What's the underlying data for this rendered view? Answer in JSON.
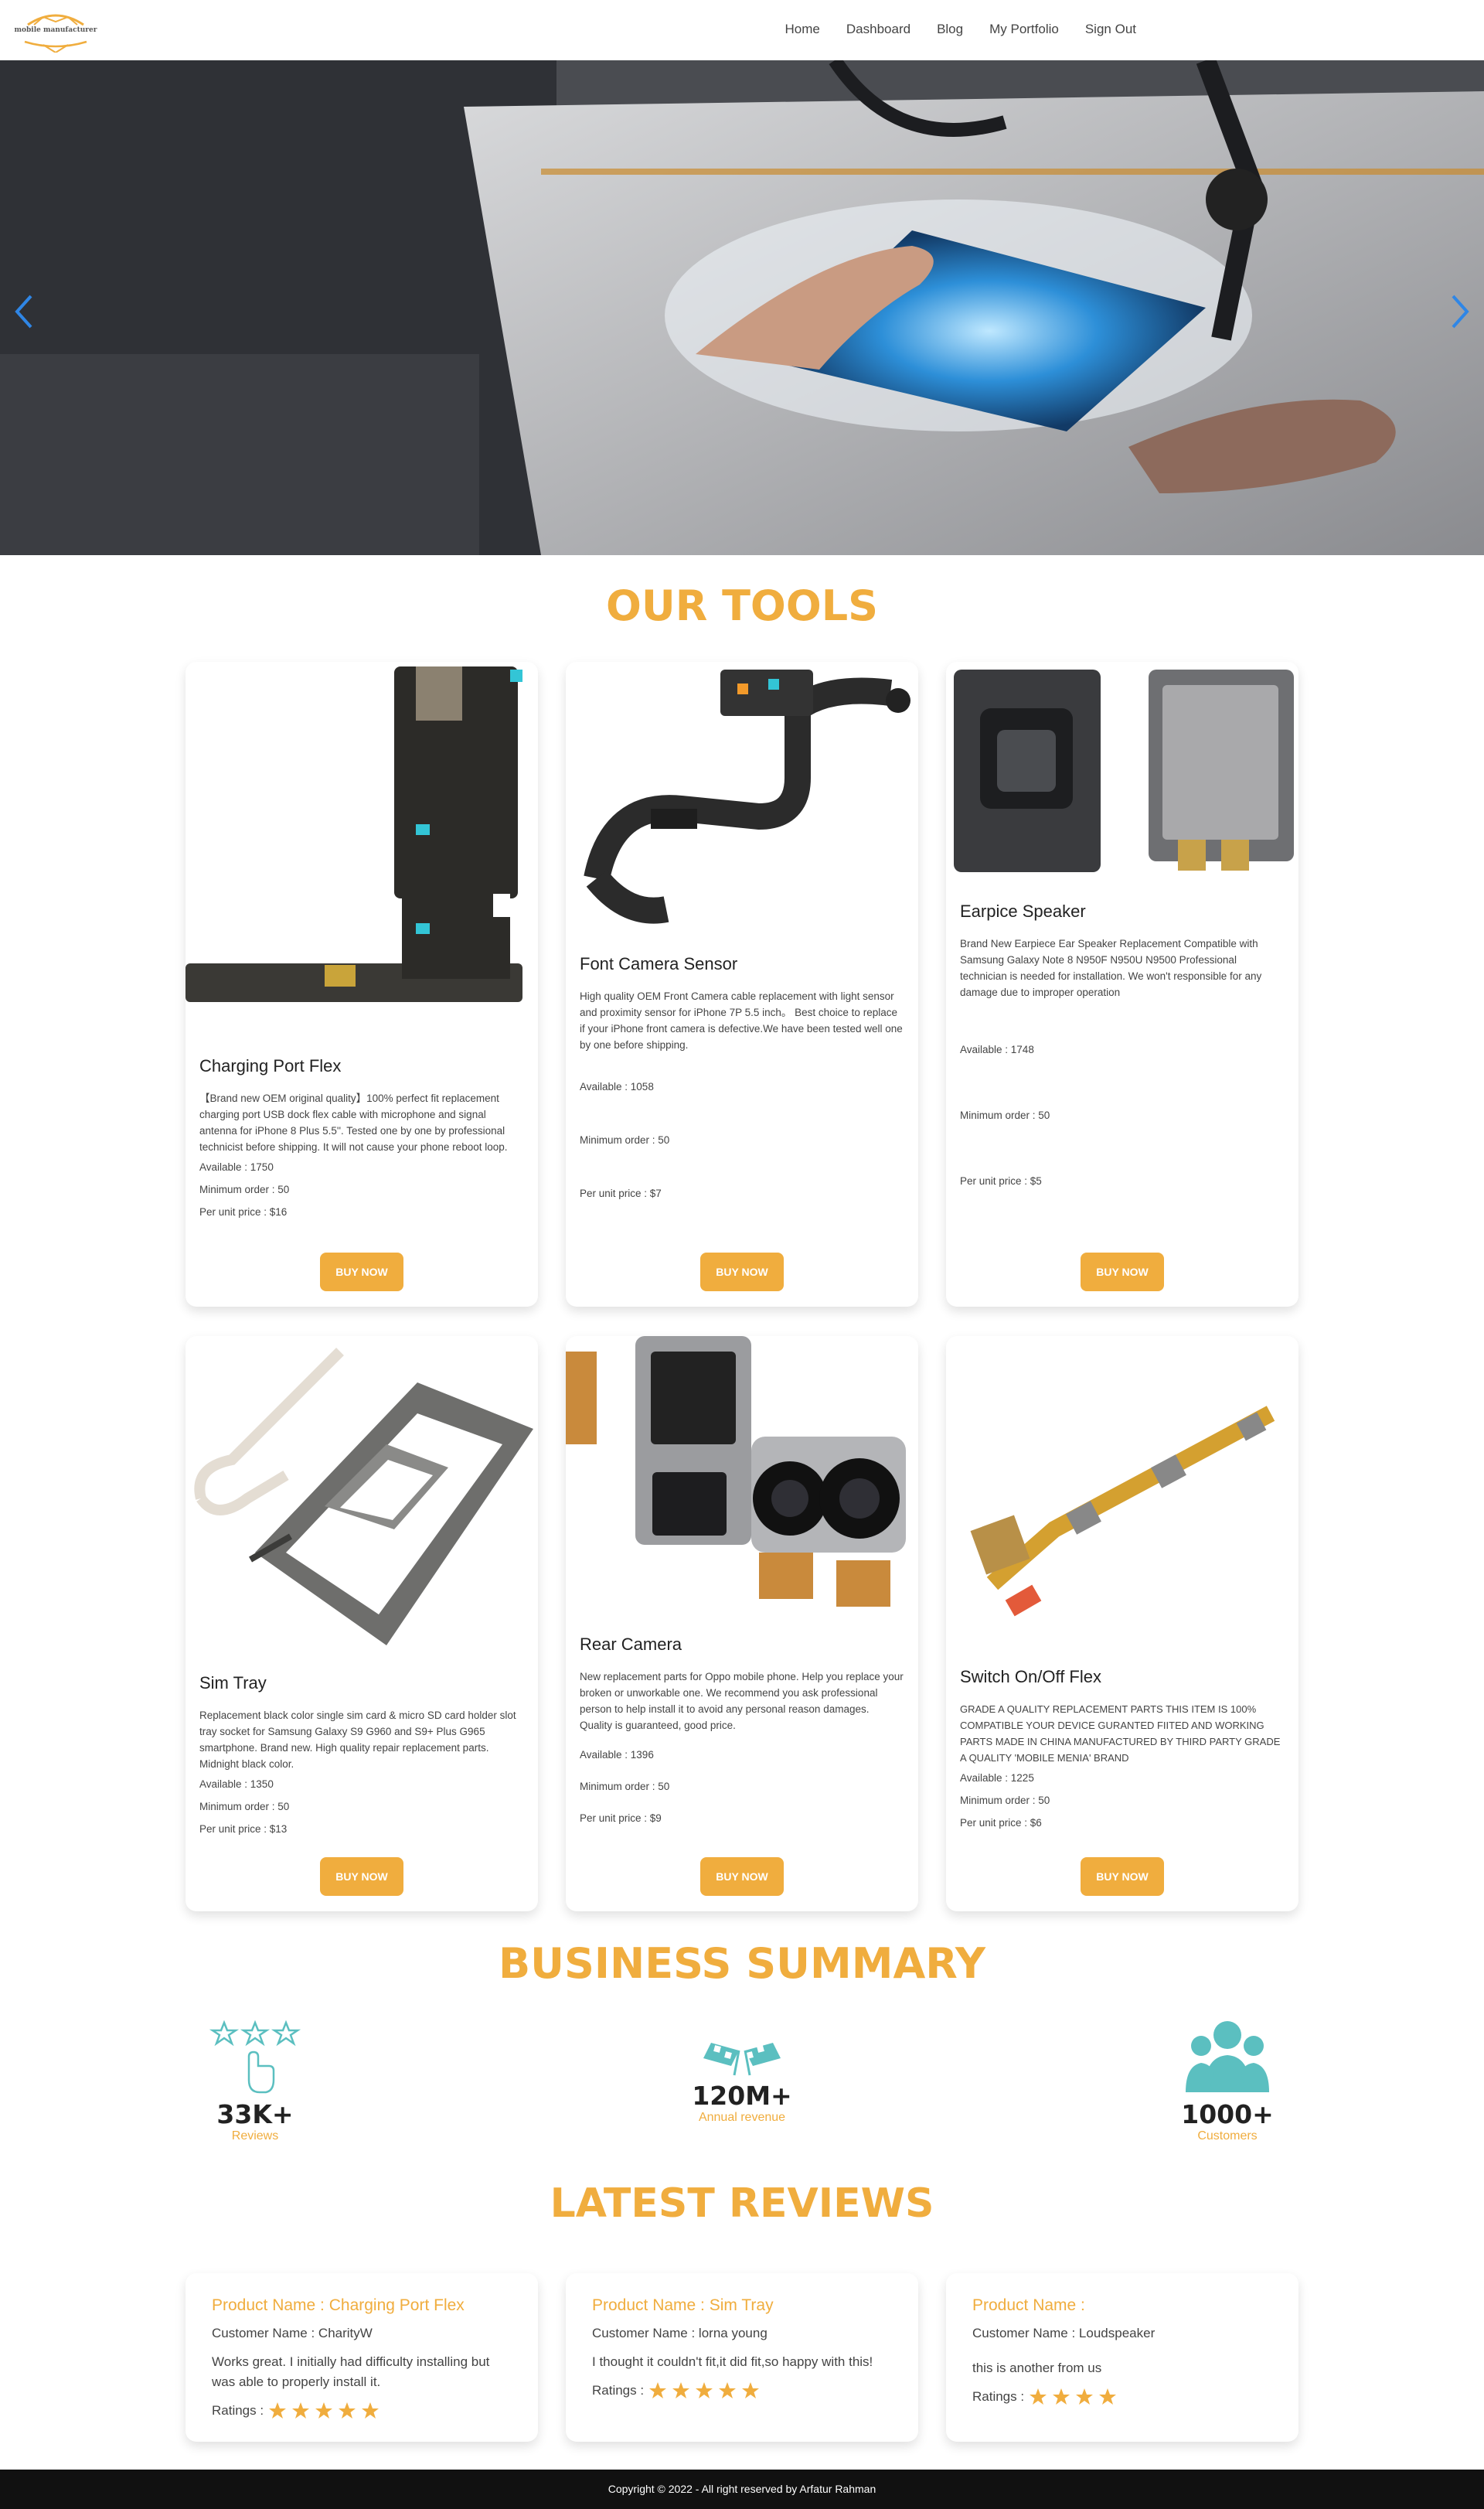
{
  "nav": {
    "logo_text": "mobile manufacturer",
    "links": [
      "Home",
      "Dashboard",
      "Blog",
      "My Portfolio",
      "Sign Out"
    ]
  },
  "hero": {
    "prev_icon": "chevron-left-icon",
    "next_icon": "chevron-right-icon"
  },
  "tools": {
    "title": "OUR TOOLS",
    "products": [
      {
        "name": "Charging Port Flex",
        "description": "【Brand new OEM original quality】100% perfect fit replacement charging port USB dock flex cable with microphone and signal antenna for iPhone 8 Plus 5.5''. Tested one by one by professional technicist before shipping. It will not cause your phone reboot loop.",
        "available": "Available : 1750",
        "minimum": "Minimum order : 50",
        "price": "Per unit price : $16",
        "button": "BUY NOW"
      },
      {
        "name": "Font Camera Sensor",
        "description": "High quality OEM Front Camera cable replacement with light sensor and proximity sensor for iPhone 7P 5.5 inch。 Best choice to replace if your iPhone front camera is defective.We have been tested well one by one before shipping.",
        "available": "Available : 1058",
        "minimum": "Minimum order : 50",
        "price": "Per unit price : $7",
        "button": "BUY NOW"
      },
      {
        "name": "Earpice Speaker",
        "description": "Brand New Earpiece Ear Speaker Replacement Compatible with Samsung Galaxy Note 8 N950F N950U N9500 Professional technician is needed for installation. We won't responsible for any damage due to improper operation",
        "available": "Available : 1748",
        "minimum": "Minimum order : 50",
        "price": "Per unit price : $5",
        "button": "BUY NOW"
      },
      {
        "name": "Sim Tray",
        "description": "Replacement black color single sim card & micro SD card holder slot tray socket for Samsung Galaxy S9 G960 and S9+ Plus G965 smartphone. Brand new. High quality repair replacement parts. Midnight black color.",
        "available": "Available : 1350",
        "minimum": "Minimum order : 50",
        "price": "Per unit price : $13",
        "button": "BUY NOW"
      },
      {
        "name": "Rear Camera",
        "description": "New replacement parts for Oppo mobile phone. Help you replace your broken or unworkable one. We recommend you ask professional person to help install it to avoid any personal reason damages. Quality is guaranteed, good price.",
        "available": "Available : 1396",
        "minimum": "Minimum order : 50",
        "price": "Per unit price : $9",
        "button": "BUY NOW"
      },
      {
        "name": "Switch On/Off Flex",
        "description": "GRADE A QUALITY REPLACEMENT PARTS THIS ITEM IS 100% COMPATIBLE YOUR DEVICE GURANTED FIITED AND WORKING PARTS MADE IN CHINA MANUFACTURED BY THIRD PARTY GRADE A QUALITY 'MOBILE MENIA' BRAND",
        "available": "Available : 1225",
        "minimum": "Minimum order : 50",
        "price": "Per unit price : $6",
        "button": "BUY NOW"
      }
    ]
  },
  "summary": {
    "title": "BUSINESS SUMMARY",
    "items": [
      {
        "value": "33K+",
        "label": "Reviews",
        "icon": "star-rating-hand-icon"
      },
      {
        "value": "120M+",
        "label": "Annual revenue",
        "icon": "checkered-flags-icon"
      },
      {
        "value": "1000+",
        "label": "Customers",
        "icon": "users-group-icon"
      }
    ]
  },
  "reviews": {
    "title": "LATEST REVIEWS",
    "items": [
      {
        "product": "Product Name : Charging Port Flex",
        "customer": "Customer Name : CharityW",
        "text": "Works great. I initially had difficulty installing but was able to properly install it.",
        "ratings_label": "Ratings :",
        "stars": 5
      },
      {
        "product": "Product Name : Sim Tray",
        "customer": "Customer Name : lorna young",
        "text": "I thought it couldn't fit,it did fit,so happy with this!",
        "ratings_label": "Ratings :",
        "stars": 5
      },
      {
        "product": "Product Name :",
        "customer": "Customer Name : Loudspeaker",
        "text": "this is another from us",
        "ratings_label": "Ratings :",
        "stars": 4
      }
    ]
  },
  "footer": {
    "text": "Copyright © 2022 - All right reserved by Arfatur Rahman"
  },
  "colors": {
    "accent": "#f0ad3e",
    "teal": "#5bbfc0",
    "arrow": "#2f86e6",
    "footer_bg": "#111111"
  }
}
